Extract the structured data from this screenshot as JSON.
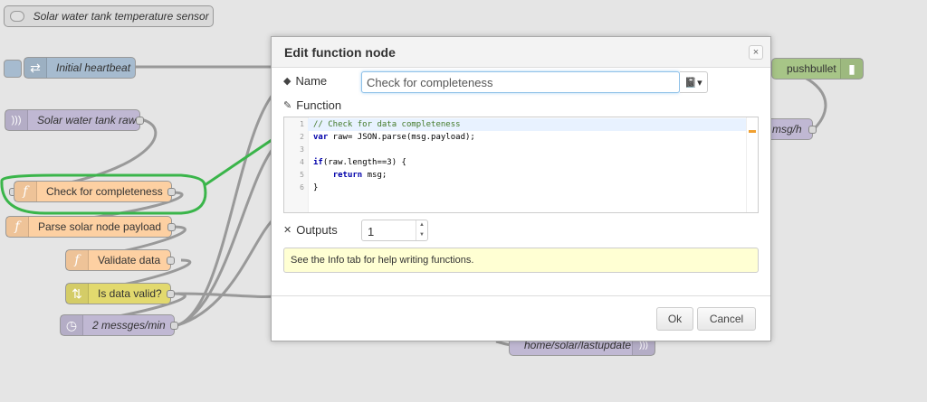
{
  "flow_nodes": [
    {
      "label": "Solar water tank temperature sensor",
      "icon": "toggle-icon",
      "color": "#d9d9d9"
    },
    {
      "label": "Initial heartbeat",
      "icon": "inject-arrows-icon",
      "color": "#a6bbcf"
    },
    {
      "label": "Solar water tank raw",
      "icon": "wifi-icon",
      "color": "#c0b8d3"
    },
    {
      "label": "Check for completeness",
      "icon": "function-icon",
      "color": "#fdd0a2"
    },
    {
      "label": "Parse solar node payload",
      "icon": "function-icon",
      "color": "#fdd0a2"
    },
    {
      "label": "Validate data",
      "icon": "function-icon",
      "color": "#fdd0a2"
    },
    {
      "label": "Is data valid?",
      "icon": "switch-icon",
      "color": "#e2d96e"
    },
    {
      "label": "2 messges/min",
      "icon": "timer-icon",
      "color": "#c0b8d3"
    },
    {
      "label": "pushbullet",
      "icon": "pushbullet-icon",
      "color": "#a7c587"
    },
    {
      "label": "msg/h",
      "icon": "",
      "color": "#c0b8d3"
    },
    {
      "label": "home/solar/lastupdate",
      "icon": "wifi-icon",
      "color": "#c0b8d3"
    }
  ],
  "highlight_color": "#3ab54a",
  "dialog": {
    "title": "Edit function node",
    "close_label": "×",
    "name_label": "Name",
    "name_value": "Check for completeness",
    "icon_picker": "📓▾",
    "function_label": "Function",
    "code_lines": [
      {
        "num": "1",
        "text": "// Check for data completeness"
      },
      {
        "num": "2",
        "text": "var raw= JSON.parse(msg.payload);"
      },
      {
        "num": "3",
        "text": ""
      },
      {
        "num": "4",
        "text": "if(raw.length==3) {"
      },
      {
        "num": "5",
        "text": "    return msg;"
      },
      {
        "num": "6",
        "text": "}"
      }
    ],
    "outputs_label": "Outputs",
    "outputs_value": "1",
    "tip": "See the Info tab for help writing functions.",
    "ok_label": "Ok",
    "cancel_label": "Cancel"
  }
}
